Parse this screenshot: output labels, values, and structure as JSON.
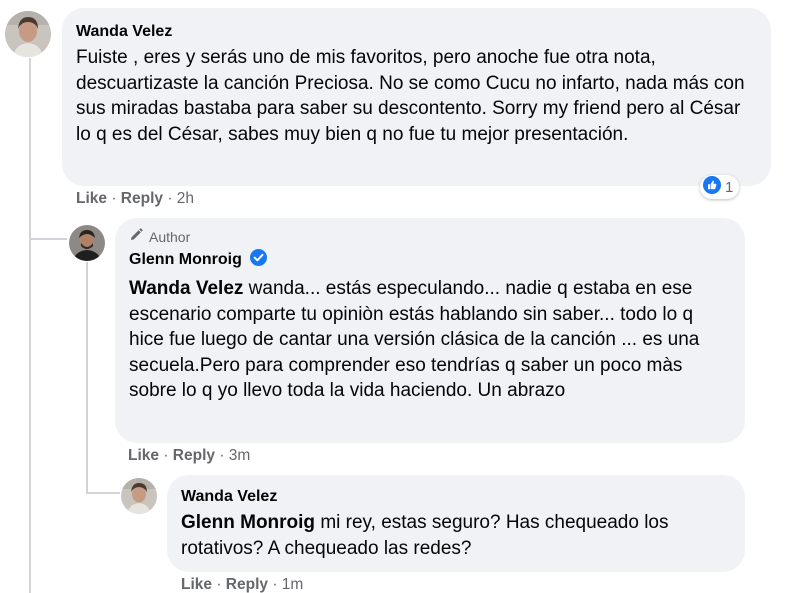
{
  "comments": [
    {
      "author": "Wanda Velez",
      "text": "Fuiste , eres y serás uno de mis favoritos, pero anoche fue otra nota, descuartizaste la canción Preciosa. No se como Cucu no infarto, nada más con sus miradas bastaba para saber su descontento. Sorry my friend pero al César lo q es del César, sabes muy bien q no fue tu mejor presentación.",
      "like_label": "Like",
      "reply_label": "Reply",
      "separator": "·",
      "time": "2h",
      "reaction_icon": "like-thumb-icon",
      "reaction_count": "1"
    },
    {
      "author_badge": "Author",
      "author": "Glenn Monroig",
      "verified_icon": "verified-badge-icon",
      "mention": "Wanda Velez",
      "text": "wanda... estás especulando... nadie q estaba en ese escenario comparte tu opiniòn estás hablando sin saber... todo lo q hice fue luego de cantar una versión clásica de la canción ... es una secuela.Pero para comprender eso tendrías q saber un poco màs sobre lo q yo llevo toda la vida haciendo. Un abrazo",
      "like_label": "Like",
      "reply_label": "Reply",
      "separator": "·",
      "time": "3m"
    },
    {
      "author": "Wanda Velez",
      "mention": "Glenn Monroig",
      "text": "mi rey, estas seguro? Has chequeado los rotativos? A chequeado las redes?",
      "like_label": "Like",
      "reply_label": "Reply",
      "separator": "·",
      "time": "1m"
    }
  ],
  "colors": {
    "bubble": "#f0f2f5",
    "meta": "#65676b",
    "like_blue": "#1877f2",
    "thread_line": "#d0d3d8"
  }
}
